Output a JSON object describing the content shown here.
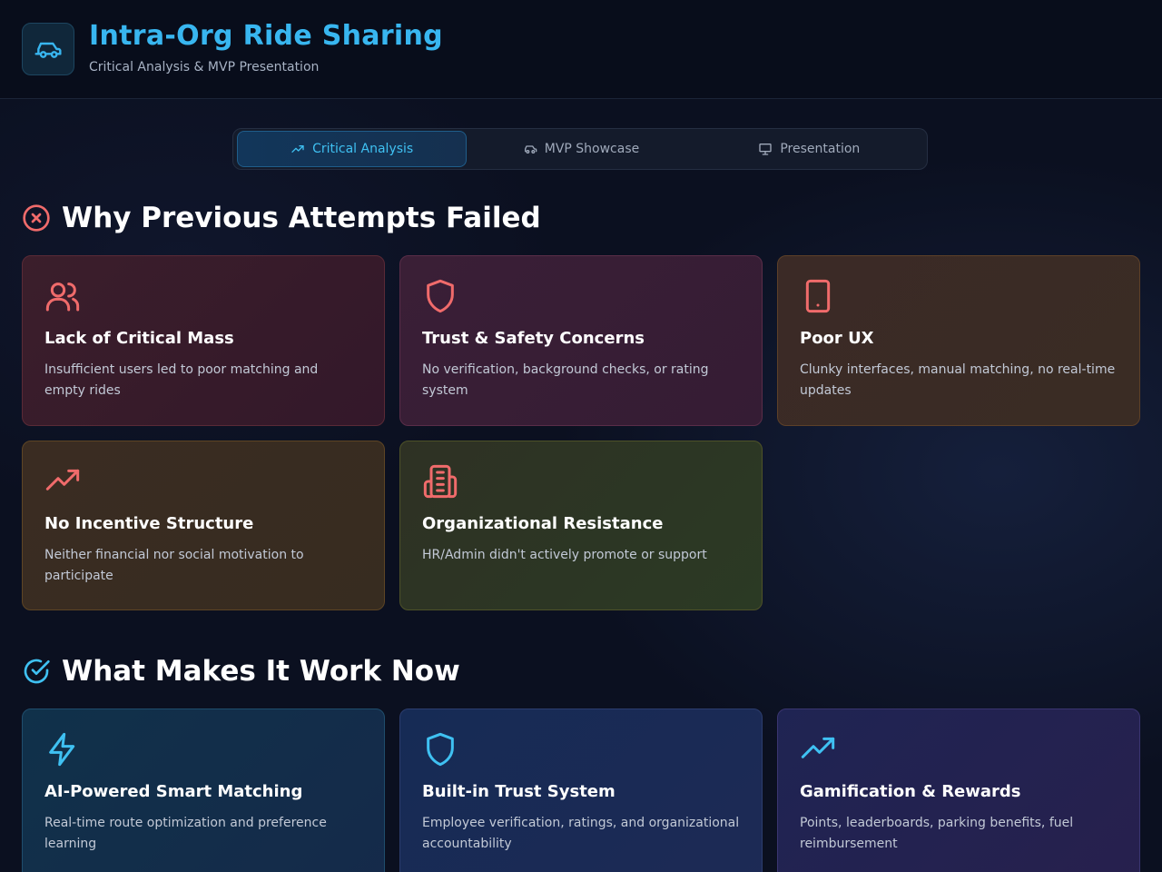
{
  "header": {
    "logo_icon": "car-icon",
    "title": "Intra-Org Ride Sharing",
    "subtitle": "Critical Analysis & MVP Presentation"
  },
  "tabs": [
    {
      "label": "Critical Analysis",
      "icon": "trending-up-icon",
      "active": true
    },
    {
      "label": "MVP Showcase",
      "icon": "car-icon",
      "active": false
    },
    {
      "label": "Presentation",
      "icon": "presentation-icon",
      "active": false
    }
  ],
  "failed": {
    "title": "Why Previous Attempts Failed",
    "icon": "x-circle-icon",
    "cards": [
      {
        "title": "Lack of Critical Mass",
        "desc": "Insufficient users led to poor matching and empty rides",
        "icon": "users-icon"
      },
      {
        "title": "Trust & Safety Concerns",
        "desc": "No verification, background checks, or rating system",
        "icon": "shield-icon"
      },
      {
        "title": "Poor UX",
        "desc": "Clunky interfaces, manual matching, no real-time updates",
        "icon": "smartphone-icon"
      },
      {
        "title": "No Incentive Structure",
        "desc": "Neither financial nor social motivation to participate",
        "icon": "trending-up-icon"
      },
      {
        "title": "Organizational Resistance",
        "desc": "HR/Admin didn't actively promote or support",
        "icon": "building-icon"
      }
    ]
  },
  "works": {
    "title": "What Makes It Work Now",
    "icon": "check-circle-icon",
    "cards": [
      {
        "title": "AI-Powered Smart Matching",
        "desc": "Real-time route optimization and preference learning",
        "icon": "zap-icon"
      },
      {
        "title": "Built-in Trust System",
        "desc": "Employee verification, ratings, and organizational accountability",
        "icon": "shield-icon"
      },
      {
        "title": "Gamification & Rewards",
        "desc": "Points, leaderboards, parking benefits, fuel reimbursement",
        "icon": "trending-up-icon"
      }
    ]
  },
  "colors": {
    "accent": "#38b6f0",
    "danger_icon": "#f06b6b",
    "success_icon": "#3fc1f2"
  }
}
